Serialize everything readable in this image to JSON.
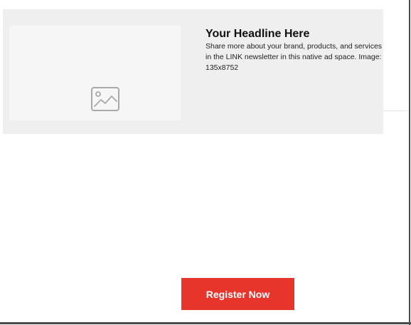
{
  "ad": {
    "headline": "Your Headline Here",
    "body": "Share more about your brand, products, and services in the LINK newsletter in this native ad space. Image: 135x8752",
    "image_icon": "image-placeholder-icon"
  },
  "cta": {
    "register_label": "Register Now"
  },
  "colors": {
    "button": "#e8352c",
    "card_background": "#efefef",
    "image_background": "#f6f6f6",
    "frame_border": "#4a4a4a"
  }
}
